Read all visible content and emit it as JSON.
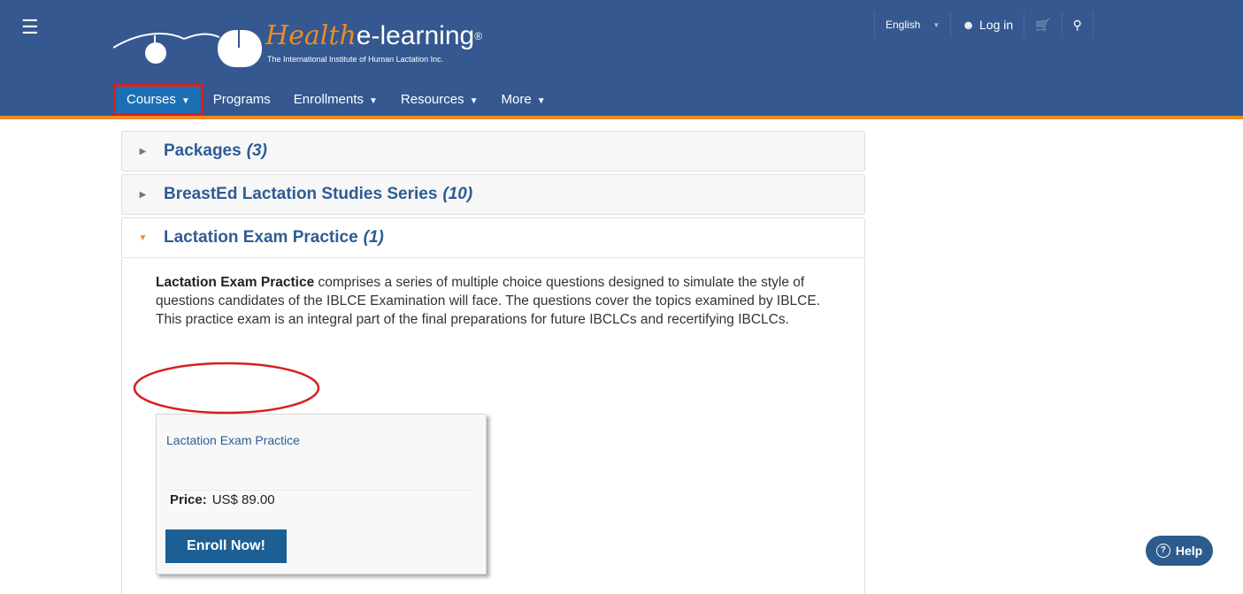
{
  "header": {
    "menu_icon": "hamburger-icon",
    "logo": {
      "script_text": "Health",
      "title": "e-learning",
      "registered": "®",
      "subtitle": "The International Institute of Human Lactation Inc."
    },
    "topbar": {
      "language": "English",
      "login_label": "Log in",
      "user_icon": "user-icon",
      "cart_icon": "cart-icon",
      "search_icon": "search-icon"
    },
    "nav": [
      {
        "label": "Courses",
        "dropdown": true
      },
      {
        "label": "Programs",
        "dropdown": false
      },
      {
        "label": "Enrollments",
        "dropdown": true
      },
      {
        "label": "Resources",
        "dropdown": true
      },
      {
        "label": "More",
        "dropdown": true
      }
    ]
  },
  "categories": [
    {
      "title": "Packages",
      "count": "(3)",
      "expanded": false
    },
    {
      "title": "BreastEd Lactation Studies Series",
      "count": "(10)",
      "expanded": false
    },
    {
      "title": "Lactation Exam Practice",
      "count": "(1)",
      "expanded": true
    }
  ],
  "expanded": {
    "description_bold": "Lactation Exam Practice",
    "description_rest": " comprises a series of multiple choice questions designed to simulate the style of questions candidates of the IBLCE Examination will face. The questions cover the topics examined by IBLCE. This practice exam is an integral part of the final preparations for future IBCLCs and recertifying IBCLCs.",
    "product": {
      "title": "Lactation Exam Practice",
      "price_label": "Price:",
      "price_value": "US$ 89.00",
      "enroll_label": "Enroll Now!"
    }
  },
  "help": {
    "label": "Help"
  },
  "colors": {
    "header_bg": "#34588f",
    "accent_orange": "#f08a24",
    "link_blue": "#2e5c94",
    "button_blue": "#1c5f95",
    "highlight_red": "#d62020"
  }
}
